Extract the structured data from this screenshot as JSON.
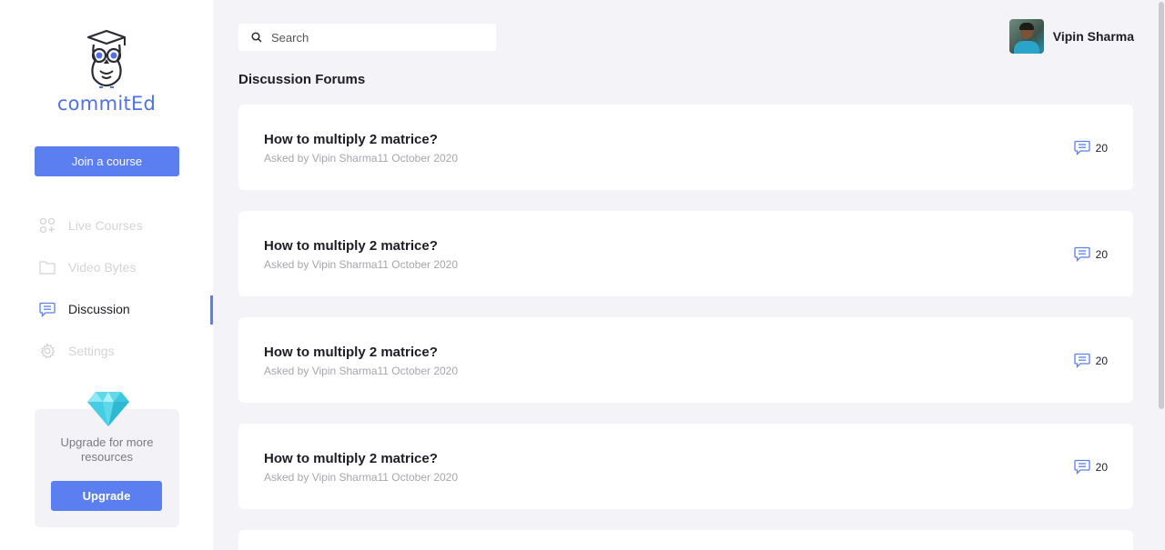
{
  "brand": {
    "name": "commitEd",
    "accent": "#5b7ff0"
  },
  "sidebar": {
    "join_label": "Join a course",
    "items": [
      {
        "label": "Live Courses",
        "icon": "grid-plus-icon",
        "active": false
      },
      {
        "label": "Video Bytes",
        "icon": "folder-icon",
        "active": false
      },
      {
        "label": "Discussion",
        "icon": "chat-icon",
        "active": true
      },
      {
        "label": "Settings",
        "icon": "gear-icon",
        "active": false
      }
    ],
    "upgrade": {
      "text": "Upgrade for more resources",
      "button_label": "Upgrade",
      "icon": "diamond-icon"
    }
  },
  "header": {
    "search": {
      "placeholder": "Search",
      "value": ""
    },
    "user": {
      "name": "Vipin Sharma"
    }
  },
  "main": {
    "title": "Discussion Forums",
    "threads": [
      {
        "title": "How to multiply 2 matrice?",
        "meta": "Asked by Vipin Sharma11 October 2020",
        "count": "20"
      },
      {
        "title": "How to multiply 2 matrice?",
        "meta": "Asked by Vipin Sharma11 October 2020",
        "count": "20"
      },
      {
        "title": "How to multiply 2 matrice?",
        "meta": "Asked by Vipin Sharma11 October 2020",
        "count": "20"
      },
      {
        "title": "How to multiply 2 matrice?",
        "meta": "Asked by Vipin Sharma11 October 2020",
        "count": "20"
      }
    ]
  }
}
